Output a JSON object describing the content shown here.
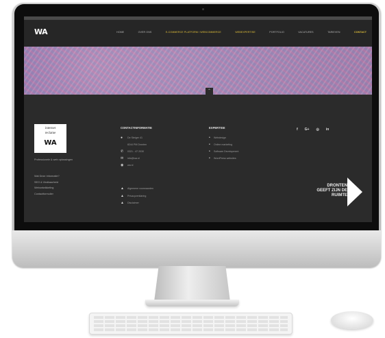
{
  "nav": {
    "logo": "WA",
    "items": [
      {
        "label": "HOME",
        "style": "normal"
      },
      {
        "label": "OVER ONS",
        "style": "normal"
      },
      {
        "label": "E-COMMERCE PLATFORM / WEBCOMMERCE",
        "style": "accent"
      },
      {
        "label": "WEBEXPERTISE",
        "style": "accent"
      },
      {
        "label": "PORTFOLIO",
        "style": "normal"
      },
      {
        "label": "VACATURES",
        "style": "normal"
      },
      {
        "label": "TARIEVEN",
        "style": "normal"
      },
      {
        "label": "CONTACT",
        "style": "contact"
      }
    ],
    "accent_color": "#e4c23a"
  },
  "hero": {
    "scroll_icon": "chevron-up-icon"
  },
  "brand": {
    "line1": "internet",
    "line2": "reclame",
    "mark": "WA"
  },
  "footer": {
    "tagline": "Professionele & web oplossingen",
    "left_links": [
      "Wat Deze Informatie?",
      "SEO & Vindbaarheid",
      "Webontwikkeling",
      "Contactformulier"
    ],
    "contact": {
      "heading": "CONTACTINFORMATIE",
      "rows": [
        {
          "icon": "location-icon",
          "text": "De Steiger 41"
        },
        {
          "icon": "",
          "text": "8244 PM Dronten"
        },
        {
          "icon": "phone-icon",
          "text": "0321 - 47 2030"
        },
        {
          "icon": "mail-icon",
          "text": "info@wa.nl"
        },
        {
          "icon": "globe-icon",
          "text": "wa.nl"
        }
      ],
      "links": [
        {
          "icon": "warning-icon",
          "text": "Algemene voorwaarden"
        },
        {
          "icon": "warning-icon",
          "text": "Privacyverklaring"
        },
        {
          "icon": "warning-icon",
          "text": "Disclaimer"
        }
      ]
    },
    "expertise": {
      "heading": "EXPERTISE",
      "items": [
        "Webdesign",
        "Online marketing",
        "Software Development",
        "WordPress websites"
      ]
    },
    "social": [
      {
        "icon": "facebook-icon",
        "glyph": "f"
      },
      {
        "icon": "google-plus-icon",
        "glyph": "G+"
      },
      {
        "icon": "instagram-icon",
        "glyph": "◎"
      },
      {
        "icon": "linkedin-icon",
        "glyph": "in"
      }
    ],
    "promo": [
      "DRONTEN",
      "GEEFT ZIJN DE",
      "RUIMTE"
    ]
  }
}
